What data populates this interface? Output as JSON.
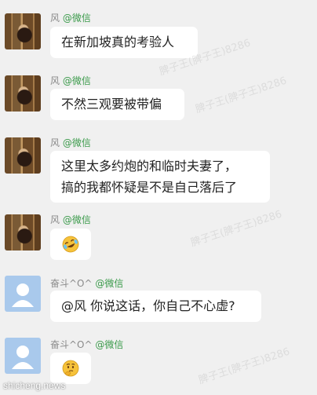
{
  "messages": [
    {
      "sender": "风",
      "source": "@微信",
      "avatar": "photo",
      "lines": [
        "在新加坡真的考验人"
      ]
    },
    {
      "sender": "风",
      "source": "@微信",
      "avatar": "photo",
      "lines": [
        "不然三观要被带偏"
      ]
    },
    {
      "sender": "风",
      "source": "@微信",
      "avatar": "photo",
      "lines": [
        "这里太多约炮的和临时夫妻了，",
        "搞的我都怀疑是不是自己落后了"
      ]
    },
    {
      "sender": "风",
      "source": "@微信",
      "avatar": "photo",
      "emoji": "face-with-tears-of-joy-sideways"
    },
    {
      "sender": "奋斗^O^",
      "source": "@微信",
      "avatar": "default",
      "lines": [
        "@风 你说这话，你自己不心虚?"
      ]
    },
    {
      "sender": "奋斗^O^",
      "source": "@微信",
      "avatar": "default",
      "emoji": "thinking-face"
    }
  ],
  "watermarks": [
    "脾子王(脾子王)8286",
    "脾子王(脾子王)8286",
    "脾子王(脾子王)8286",
    "脾子王(脾子王)8286"
  ],
  "site_watermark": "shicheng.news"
}
